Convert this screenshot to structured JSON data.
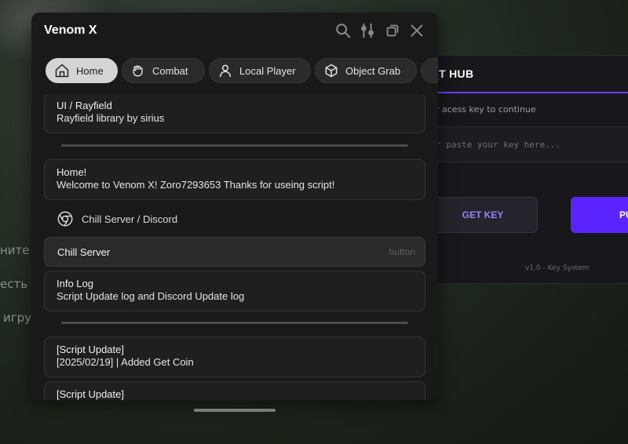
{
  "background": {
    "menu_items": [
      "ните",
      "есть",
      "игру"
    ]
  },
  "key_system": {
    "title": "_T HUB",
    "subtitle": "r acess key to continue",
    "input_placeholder": "r paste your key here...",
    "get_key_label": "GET KEY",
    "submit_label": "PU",
    "version": "v1.0 - Key System",
    "accent_color": "#6a41ff"
  },
  "window": {
    "title": "Venom X",
    "top_icons": [
      "search-icon",
      "sliders-icon",
      "minimize-icon",
      "close-icon"
    ],
    "tabs": [
      {
        "label": "Home",
        "icon": "home-icon",
        "active": true
      },
      {
        "label": "Combat",
        "icon": "fist-icon",
        "active": false
      },
      {
        "label": "Local Player",
        "icon": "user-icon",
        "active": false
      },
      {
        "label": "Object Grab",
        "icon": "cube-icon",
        "active": false
      }
    ],
    "content": {
      "card_ui": {
        "title": "UI / Rayfield",
        "text": "Rayfield library by sirius"
      },
      "card_home": {
        "title": "Home!",
        "text": "Welcome to Venom X! Zoro7293653 Thanks for useing script!"
      },
      "section_discord": {
        "label": "Chill Server / Discord",
        "icon": "chrome-icon"
      },
      "button_chill": {
        "label": "Chill Server",
        "hint": "button"
      },
      "card_info": {
        "title": "Info Log",
        "text": "Script Update log and Discord Update log"
      },
      "card_update1": {
        "title": "[Script Update]",
        "text": "[2025/02/19] | Added Get Coin"
      },
      "card_update2": {
        "title": "[Script Update]"
      }
    }
  }
}
